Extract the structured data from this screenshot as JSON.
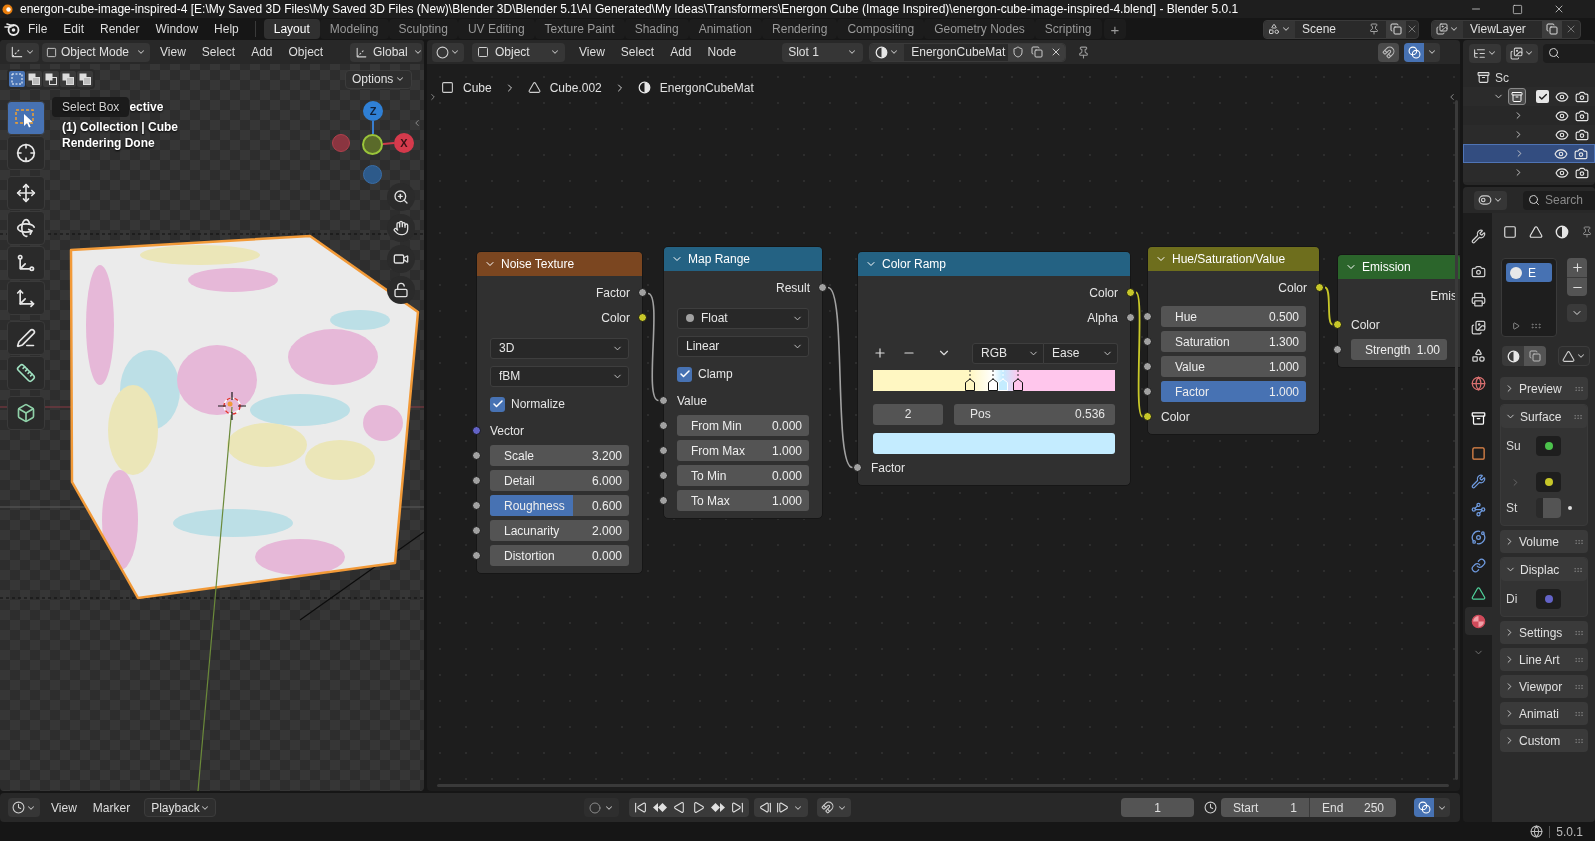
{
  "title_bar": {
    "title": "energon-cube-image-inspired-4 [E:\\My Saved 3D Files\\My Saved 3D Files (New)\\Blender 3D\\Blender 5.1\\AI Generated\\My Ideas\\Transformers\\Energon Cube (Image Inspired)\\energon-cube-image-inspired-4.blend] - Blender 5.0.1"
  },
  "menu_bar": {
    "menus": [
      "File",
      "Edit",
      "Render",
      "Window",
      "Help"
    ],
    "workspaces": [
      {
        "label": "Layout",
        "selected": true
      },
      {
        "label": "Modeling",
        "selected": false
      },
      {
        "label": "Sculpting",
        "selected": false
      },
      {
        "label": "UV Editing",
        "selected": false
      },
      {
        "label": "Texture Paint",
        "selected": false
      },
      {
        "label": "Shading",
        "selected": false
      },
      {
        "label": "Animation",
        "selected": false
      },
      {
        "label": "Rendering",
        "selected": false
      },
      {
        "label": "Compositing",
        "selected": false
      },
      {
        "label": "Geometry Nodes",
        "selected": false
      },
      {
        "label": "Scripting",
        "selected": false
      }
    ],
    "add_workspace": "+",
    "scene": "Scene",
    "view_layer": "ViewLayer"
  },
  "viewport": {
    "mode": "Object Mode",
    "menus": [
      "View",
      "Select",
      "Add",
      "Object"
    ],
    "orientation": "Global",
    "options": "Options",
    "select_modes": [
      {
        "selected": true
      },
      {
        "selected": false
      },
      {
        "selected": false
      },
      {
        "selected": false
      },
      {
        "selected": false
      }
    ],
    "tools": [
      {
        "kind": "select",
        "selected": true
      },
      {
        "kind": "cursor",
        "selected": false
      },
      {
        "kind": "move",
        "selected": false
      },
      {
        "kind": "rotate",
        "selected": false
      },
      {
        "kind": "scale",
        "selected": false
      },
      {
        "kind": "transform",
        "selected": false
      },
      {
        "kind": "annotate",
        "selected": false
      },
      {
        "kind": "measure",
        "selected": false
      },
      {
        "kind": "add_cube",
        "selected": false
      }
    ],
    "tooltip": "Select Box",
    "info_lines": [
      "ective",
      "(1) Collection | Cube",
      "Rendering Done"
    ],
    "gizmo": {
      "z": "Z",
      "x": "X"
    }
  },
  "node_editor": {
    "type": "Object",
    "menus": [
      "View",
      "Select",
      "Add",
      "Node"
    ],
    "slot": "Slot 1",
    "material": "EnergonCubeMat",
    "breadcrumbs": [
      {
        "kind": "object",
        "label": "Cube"
      },
      {
        "kind": "mesh",
        "label": "Cube.002"
      },
      {
        "kind": "material",
        "label": "EnergonCubeMat"
      }
    ],
    "nodes": [
      {
        "kind": "texture",
        "title": "Noise Texture",
        "rows": [
          {
            "kind": "output",
            "label": "Factor",
            "color": "#a1a1a1"
          },
          {
            "kind": "output",
            "label": "Color",
            "color": "#c7c729"
          },
          {
            "kind": "dropdown",
            "value": "3D"
          },
          {
            "kind": "dropdown",
            "value": "fBM"
          },
          {
            "kind": "checkbox",
            "label": "Normalize",
            "checked": true
          },
          {
            "kind": "input",
            "label": "Vector",
            "color": "#6363c7"
          },
          {
            "kind": "field",
            "label": "Scale",
            "value": "3.200",
            "color": "#a1a1a1"
          },
          {
            "kind": "field",
            "label": "Detail",
            "value": "6.000",
            "color": "#a1a1a1"
          },
          {
            "kind": "slider",
            "label": "Roughness",
            "value": "0.600",
            "color": "#a1a1a1",
            "level": 0.6
          },
          {
            "kind": "field",
            "label": "Lacunarity",
            "value": "2.000",
            "color": "#a1a1a1"
          },
          {
            "kind": "field",
            "label": "Distortion",
            "value": "0.000",
            "color": "#a1a1a1"
          }
        ]
      },
      {
        "kind": "converter",
        "title": "Map Range",
        "rows": [
          {
            "kind": "output",
            "label": "Result",
            "color": "#a1a1a1"
          },
          {
            "kind": "type_dropdown",
            "value": "Float"
          },
          {
            "kind": "dropdown",
            "value": "Linear"
          },
          {
            "kind": "checkbox",
            "label": "Clamp",
            "checked": true
          },
          {
            "kind": "input",
            "label": "Value",
            "color": "#a1a1a1"
          },
          {
            "kind": "field",
            "label": "From Min",
            "value": "0.000",
            "color": "#a1a1a1"
          },
          {
            "kind": "field",
            "label": "From Max",
            "value": "1.000",
            "color": "#a1a1a1"
          },
          {
            "kind": "field",
            "label": "To Min",
            "value": "0.000",
            "color": "#a1a1a1"
          },
          {
            "kind": "field",
            "label": "To Max",
            "value": "1.000",
            "color": "#a1a1a1"
          }
        ]
      },
      {
        "kind": "converter",
        "title": "Color Ramp",
        "rows": [
          {
            "kind": "output",
            "label": "Color",
            "color": "#c7c729"
          },
          {
            "kind": "output",
            "label": "Alpha",
            "color": "#a1a1a1"
          },
          {
            "kind": "ramp_toolbar",
            "color_mode": "RGB",
            "interpolation": "Ease"
          },
          {
            "kind": "ramp",
            "stops": [
              {
                "level": 0.4,
                "color": "#fff7c2",
                "selected": false
              },
              {
                "level": 0.497,
                "color": "#ffffff",
                "selected": false
              },
              {
                "level": 0.536,
                "color": "#c4ecff",
                "selected": true
              },
              {
                "level": 0.601,
                "color": "#ffc6ec",
                "selected": false
              }
            ]
          },
          {
            "kind": "stop_fields",
            "index": "2",
            "label": "Pos",
            "value": "0.536"
          },
          {
            "kind": "swatch",
            "color": "#c4ecff"
          },
          {
            "kind": "input",
            "label": "Factor",
            "color": "#a1a1a1"
          }
        ]
      },
      {
        "kind": "color",
        "title": "Hue/Saturation/Value",
        "rows": [
          {
            "kind": "output",
            "label": "Color",
            "color": "#c7c729"
          },
          {
            "kind": "field",
            "label": "Hue",
            "value": "0.500",
            "color": "#a1a1a1"
          },
          {
            "kind": "field",
            "label": "Saturation",
            "value": "1.300",
            "color": "#a1a1a1"
          },
          {
            "kind": "field",
            "label": "Value",
            "value": "1.000",
            "color": "#a1a1a1"
          },
          {
            "kind": "slider",
            "label": "Factor",
            "value": "1.000",
            "color": "#a1a1a1",
            "level": 1
          },
          {
            "kind": "input",
            "label": "Color",
            "color": "#c7c729"
          }
        ]
      },
      {
        "kind": "shader",
        "title": "Emission",
        "rows": [
          {
            "kind": "output",
            "label": "Emis"
          },
          {
            "kind": "input",
            "label": "Color",
            "color": "#c7c729"
          },
          {
            "kind": "field",
            "label": "Strength",
            "value": "1.00",
            "color": "#a1a1a1"
          }
        ]
      }
    ]
  },
  "outliner": {
    "tree": [
      {
        "kind": "scene_collection",
        "label": "Sc",
        "selected": false,
        "children": [
          {
            "kind": "collection",
            "expanded": true,
            "checked": true,
            "selected": false,
            "children": [
              {
                "kind": "object",
                "expanded": false,
                "selected": false
              },
              {
                "kind": "object",
                "expanded": false,
                "selected": false
              },
              {
                "kind": "object",
                "expanded": false,
                "selected": true
              },
              {
                "kind": "object",
                "expanded": false,
                "selected": false
              }
            ]
          }
        ]
      }
    ]
  },
  "properties": {
    "search_placeholder": "Search",
    "tab_groups": [
      {
        "tabs": [
          {
            "kind": "tool",
            "selected": false
          }
        ]
      },
      {
        "tabs": [
          {
            "kind": "render",
            "selected": false
          },
          {
            "kind": "output",
            "selected": false
          },
          {
            "kind": "view_layer",
            "selected": false
          },
          {
            "kind": "scene",
            "selected": false
          },
          {
            "kind": "world",
            "selected": false
          }
        ]
      },
      {
        "tabs": [
          {
            "kind": "collection",
            "selected": false
          }
        ]
      },
      {
        "tabs": [
          {
            "kind": "object",
            "selected": false
          },
          {
            "kind": "modifiers",
            "selected": false
          },
          {
            "kind": "particles",
            "selected": false
          },
          {
            "kind": "physics",
            "selected": false
          },
          {
            "kind": "constraints",
            "selected": false
          },
          {
            "kind": "data",
            "selected": false
          },
          {
            "kind": "material",
            "selected": true
          }
        ]
      }
    ],
    "material_slots": [
      {
        "label": "E",
        "selected": true
      }
    ],
    "panels": [
      {
        "title": "Preview",
        "expanded": false
      },
      {
        "title": "Surface",
        "expanded": true,
        "rows": [
          {
            "kind": "socket",
            "label": "Su",
            "color": "#4cc24c"
          },
          {
            "kind": "linked",
            "color": "#c7c729"
          },
          {
            "kind": "value",
            "label": "St"
          }
        ]
      },
      {
        "title": "Volume",
        "expanded": false
      },
      {
        "title": "Displac",
        "expanded": true,
        "rows": [
          {
            "kind": "socket",
            "label": "Di",
            "color": "#6363c7"
          }
        ]
      },
      {
        "title": "Settings",
        "expanded": false
      },
      {
        "title": "Line Art",
        "expanded": false
      },
      {
        "title": "Viewpor",
        "expanded": false
      },
      {
        "title": "Animati",
        "expanded": false
      },
      {
        "title": "Custom",
        "expanded": false
      }
    ]
  },
  "timeline": {
    "menus": [
      "View",
      "Marker"
    ],
    "playback": "Playback",
    "current_frame": "1",
    "start_label": "Start",
    "start": "1",
    "end_label": "End",
    "end": "250"
  },
  "status_bar": {
    "version": "5.0.1"
  }
}
